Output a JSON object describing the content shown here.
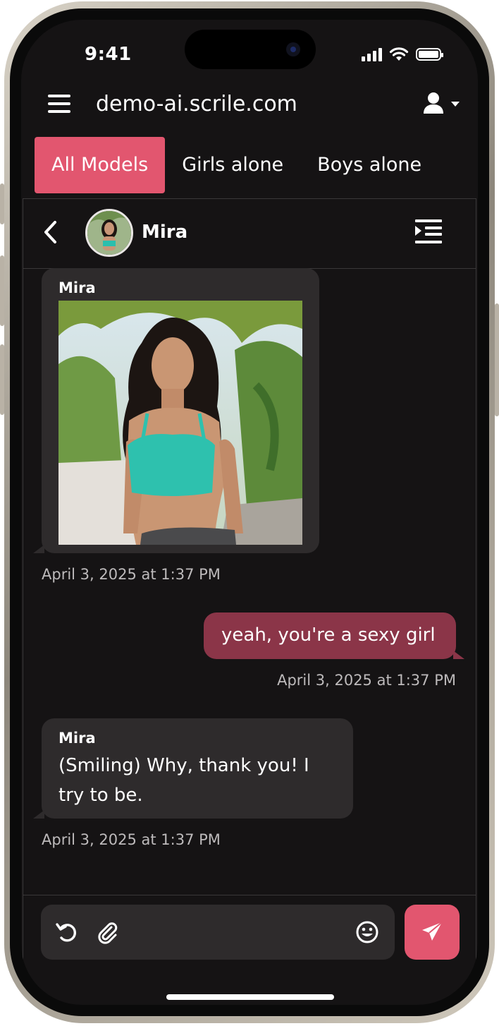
{
  "status_bar": {
    "time": "9:41"
  },
  "header": {
    "site": "demo-ai.scrile.com"
  },
  "tabs": [
    {
      "label": "All Models",
      "active": true
    },
    {
      "label": "Girls alone",
      "active": false
    },
    {
      "label": "Boys alone",
      "active": false
    }
  ],
  "chat": {
    "contact_name": "Mira",
    "messages": [
      {
        "from": "model",
        "sender": "Mira",
        "type": "image",
        "time": "April 3, 2025 at 1:37 PM"
      },
      {
        "from": "user",
        "text": "yeah, you're a sexy girl",
        "time": "April 3, 2025 at 1:37 PM"
      },
      {
        "from": "model",
        "sender": "Mira",
        "text_line1": "(Smiling) Why, thank you! I",
        "text_line2": "try to be.",
        "time": "April 3, 2025 at 1:37 PM"
      }
    ]
  },
  "colors": {
    "accent": "#e2566f",
    "user_bubble": "#8b3548",
    "model_bubble": "#2e2b2c",
    "background": "#151314"
  },
  "icons": [
    "menu-icon",
    "user-icon",
    "back-icon",
    "sidebar-toggle-icon",
    "undo-icon",
    "paperclip-icon",
    "emoji-icon",
    "send-icon"
  ]
}
